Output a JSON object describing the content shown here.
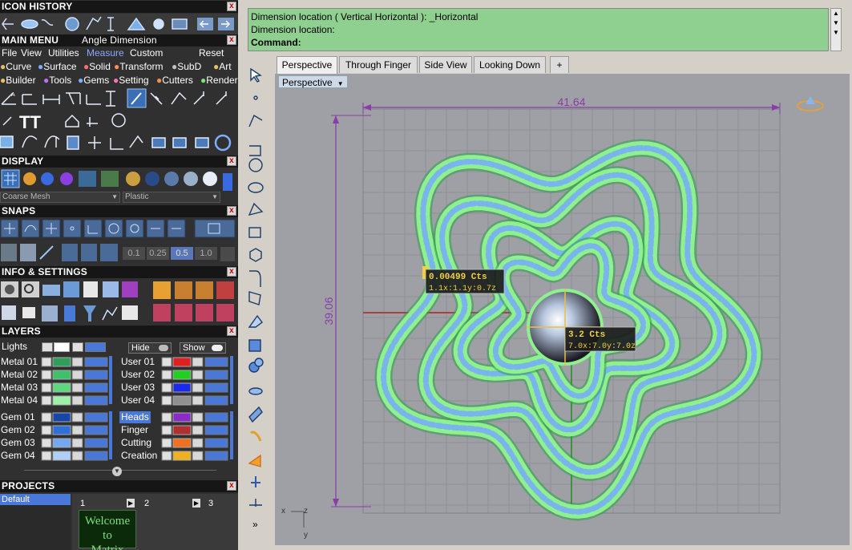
{
  "icon_history": {
    "title": "ICON HISTORY"
  },
  "main_menu": {
    "title": "MAIN MENU",
    "subtitle": "Angle Dimension",
    "menu_items": [
      "File",
      "View",
      "Utilities",
      "Measure",
      "Custom"
    ],
    "reset_label": "Reset",
    "tabs_row1": [
      {
        "label": "Curve",
        "color": "#e8c060"
      },
      {
        "label": "Surface",
        "color": "#7ab0ff"
      },
      {
        "label": "Solid",
        "color": "#ff7070"
      },
      {
        "label": "Transform",
        "color": "#ff9050"
      },
      {
        "label": "SubD",
        "color": "#c0c0c0"
      },
      {
        "label": "Art",
        "color": "#e8c060"
      }
    ],
    "tabs_row2": [
      {
        "label": "Builder",
        "color": "#e8c060"
      },
      {
        "label": "Tools",
        "color": "#c070ff"
      },
      {
        "label": "Gems",
        "color": "#7ab0ff"
      },
      {
        "label": "Setting",
        "color": "#ff70c0"
      },
      {
        "label": "Cutters",
        "color": "#ff9050"
      },
      {
        "label": "Render",
        "color": "#80e080"
      }
    ]
  },
  "display": {
    "title": "DISPLAY",
    "mesh_select": "Coarse Mesh",
    "material_select": "Plastic"
  },
  "snaps": {
    "title": "SNAPS",
    "values": [
      "0.1",
      "0.25",
      "0.5",
      "1.0"
    ]
  },
  "info": {
    "title": "INFO & SETTINGS"
  },
  "layers": {
    "title": "LAYERS",
    "lights_label": "Lights",
    "hide_label": "Hide",
    "show_label": "Show",
    "left": [
      {
        "name": "Metal 01",
        "color": "#2e9e5a"
      },
      {
        "name": "Metal 02",
        "color": "#3fc06a"
      },
      {
        "name": "Metal 03",
        "color": "#5ed87f"
      },
      {
        "name": "Metal 04",
        "color": "#9ef0a8"
      },
      {
        "name": "Gem 01",
        "color": "#1746a8"
      },
      {
        "name": "Gem 02",
        "color": "#2f6fd8"
      },
      {
        "name": "Gem 03",
        "color": "#74a8f0"
      },
      {
        "name": "Gem 04",
        "color": "#aed0f8"
      }
    ],
    "right": [
      {
        "name": "User 01",
        "color": "#e02020"
      },
      {
        "name": "User 02",
        "color": "#20d020"
      },
      {
        "name": "User 03",
        "color": "#1a2ae8"
      },
      {
        "name": "User 04",
        "color": "#909090"
      },
      {
        "name": "Heads",
        "color": "#8a2cc8"
      },
      {
        "name": "Finger",
        "color": "#b03030"
      },
      {
        "name": "Cutting",
        "color": "#f07020"
      },
      {
        "name": "Creation",
        "color": "#f0b020"
      }
    ]
  },
  "projects": {
    "title": "PROJECTS",
    "list": [
      "Default"
    ],
    "slots": [
      "1",
      "2",
      "3"
    ],
    "thumb_text": [
      "Welcome to",
      "Matrix"
    ]
  },
  "command": {
    "line1": "Dimension location ( Vertical  Horizontal ): _Horizontal",
    "line2": "Dimension location:",
    "prompt": "Command:"
  },
  "viewport_tabs": [
    "Perspective",
    "Through Finger",
    "Side View",
    "Looking Down"
  ],
  "add_tab_label": "+",
  "viewport": {
    "label": "Perspective",
    "dim_horizontal": "41.64",
    "dim_vertical": "39.06",
    "tooltip_small": {
      "weight": "0.00499 Cts",
      "size": "1.1x:1.1y:0.7z"
    },
    "tooltip_large": {
      "weight": "3.2 Cts",
      "size": "7.0x:7.0y:7.0z"
    },
    "axis_x": "x",
    "axis_y": "y",
    "axis_z": "z"
  },
  "more_tools": "»",
  "colors": {
    "metal_green": "#8ef08e",
    "dimension": "#8a3ca8",
    "gem_blue": "#7ab4ec"
  }
}
